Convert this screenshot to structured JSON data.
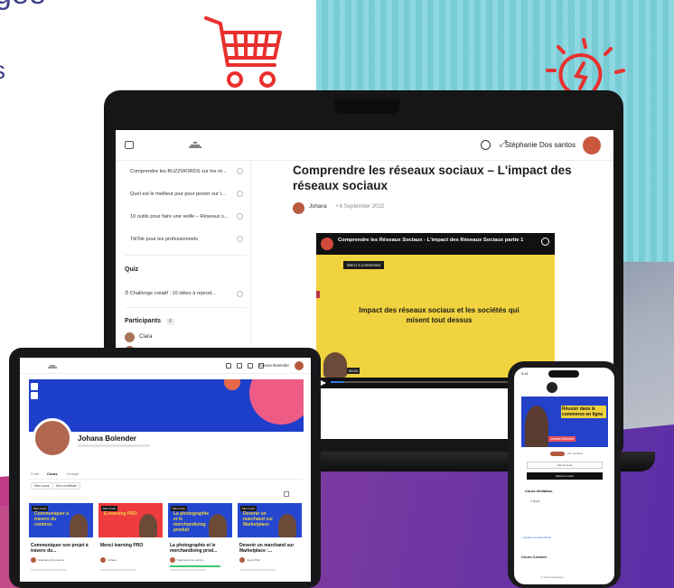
{
  "hero": {
    "line1": "gée",
    "line2": "s"
  },
  "laptop": {
    "user_name": "Stéphanie Dos santos",
    "lessons": [
      "Comprendre les BUZZWORDS sur les ré...",
      "Quel est le meilleur jour pour poster sur l...",
      "10 outils pour faire une veille – Réseaux s...",
      "TikTok pour les professionnels"
    ],
    "quiz_heading": "Quiz",
    "quiz_item": "Challenge créatif : 10 idées à reprod...",
    "participants_heading": "Participants",
    "participants_count": "6",
    "participants": [
      "Clara"
    ],
    "article_title": "Comprendre les réseaux sociaux – L'impact des réseaux sociaux",
    "author": "Johana",
    "date": "6 September 2022",
    "video": {
      "title": "Comprendre les Réseaux Sociaux - L'impact des Réseaux Sociaux partie 1",
      "button": "Merci a commenta",
      "headline": "Impact des réseaux sociaux et les sociétés qui misent tout dessus",
      "time": "00:00",
      "progress": 0.06
    }
  },
  "tablet": {
    "user_name": "Johana Bolender",
    "profile_name": "Johana Bolender",
    "tabs": [
      "Profil",
      "Cours",
      "Groupe"
    ],
    "chips": [
      "Mes cours",
      "Mes certificats"
    ],
    "cards": [
      {
        "tag": "Mon cours",
        "headline": "Communiquer à travers du contenu",
        "title": "Communiquer son projet à travers du...",
        "author": "Stéphanie Dos santos",
        "banner_color": "#2547d0",
        "headline_color": "#f0d33f"
      },
      {
        "tag": "Mon cours",
        "headline": "E-learning PRO",
        "title": "Menci learning PRO",
        "author": "Johana",
        "banner_color": "#ee3b3f",
        "headline_color": "#f0d33f"
      },
      {
        "tag": "Mon cours",
        "headline": "La photographie et le merchandising produit",
        "title": "La photographie et le merchandising prod...",
        "author": "Stéphanie Dos santos",
        "banner_color": "#2547d0",
        "headline_color": "#f0d33f",
        "progress": 0.8
      },
      {
        "tag": "Mon cours",
        "headline": "Devenir un marchand sur Marketplace",
        "title": "Devenir un marchand sur Marketplace :...",
        "author": "Laura Pillet",
        "banner_color": "#2547d0",
        "headline_color": "#f0d33f"
      }
    ]
  },
  "phone": {
    "time": "9:41",
    "hero_text": "Réussir dans le commerce en ligne",
    "hero_name": "Johana Bolender",
    "members_count": "+15 membres",
    "btn_outline": "Voir le cours",
    "btn_fill": "Suivre le cours",
    "section": "Cours Invitation",
    "lesson": "0 leçon",
    "link": "+ Ajouter une description",
    "content_heading": "Cours Content",
    "bottom": "1 cours Learning 1"
  },
  "colors": {
    "accent_red": "#e8302e",
    "banner_blue": "#1e3fcc",
    "yellow": "#f0d33f"
  }
}
